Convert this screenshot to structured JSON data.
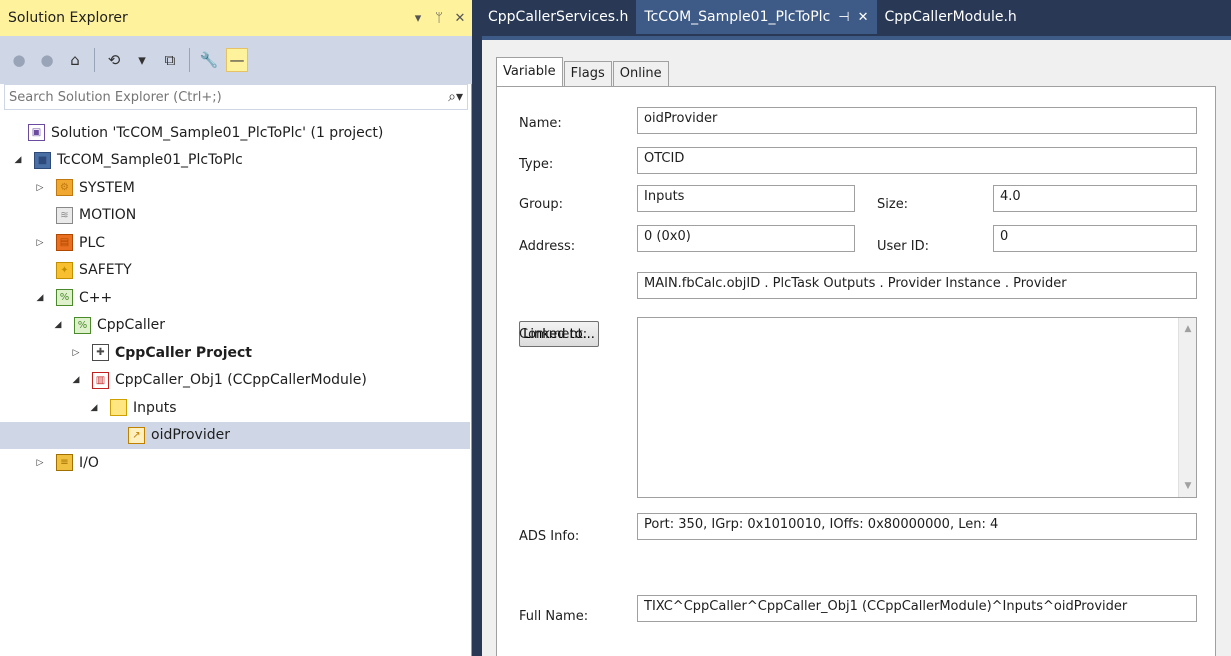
{
  "solution_explorer": {
    "title": "Solution Explorer",
    "title_controls": [
      "▾",
      "ᛘ",
      "✕"
    ],
    "toolbar": [
      "●",
      "●",
      "⌂",
      "⟲",
      "▾",
      "⧉",
      "🔧",
      "—"
    ],
    "search_placeholder": "Search Solution Explorer (Ctrl+;)",
    "tree": [
      {
        "label": "Solution 'TcCOM_Sample01_PlcToPlc' (1 project)",
        "icon": "solution-icon",
        "level": 0,
        "arrow": "",
        "bold": false,
        "selected": false
      },
      {
        "label": "TcCOM_Sample01_PlcToPlc",
        "icon": "project-icon",
        "level": 0,
        "arrow": "◢",
        "bold": false,
        "selected": false
      },
      {
        "label": "SYSTEM",
        "icon": "system-icon",
        "level": 1,
        "arrow": "▷",
        "bold": false,
        "selected": false
      },
      {
        "label": "MOTION",
        "icon": "motion-icon",
        "level": 1,
        "arrow": "",
        "bold": false,
        "selected": false
      },
      {
        "label": "PLC",
        "icon": "plc-icon",
        "level": 1,
        "arrow": "▷",
        "bold": false,
        "selected": false
      },
      {
        "label": "SAFETY",
        "icon": "safety-icon",
        "level": 1,
        "arrow": "",
        "bold": false,
        "selected": false
      },
      {
        "label": "C++",
        "icon": "cpp-icon",
        "level": 1,
        "arrow": "◢",
        "bold": false,
        "selected": false
      },
      {
        "label": "CppCaller",
        "icon": "cpp-icon",
        "level": 2,
        "arrow": "◢",
        "bold": false,
        "selected": false
      },
      {
        "label": "CppCaller Project",
        "icon": "cpp-project-icon",
        "level": 3,
        "arrow": "▷",
        "bold": true,
        "selected": false
      },
      {
        "label": "CppCaller_Obj1 (CCppCallerModule)",
        "icon": "module-icon",
        "level": 3,
        "arrow": "◢",
        "bold": false,
        "selected": false
      },
      {
        "label": "Inputs",
        "icon": "folder-icon",
        "level": 4,
        "arrow": "◢",
        "bold": false,
        "selected": false
      },
      {
        "label": "oidProvider",
        "icon": "variable-icon",
        "level": 5,
        "arrow": "",
        "bold": false,
        "selected": true
      },
      {
        "label": "I/O",
        "icon": "io-icon",
        "level": 1,
        "arrow": "▷",
        "bold": false,
        "selected": false
      }
    ]
  },
  "document_tabs": [
    {
      "label": "CppCallerServices.h",
      "active": false,
      "pin": ""
    },
    {
      "label": "TcCOM_Sample01_PlcToPlc",
      "active": true,
      "pin": "⊣"
    },
    {
      "label": "CppCallerModule.h",
      "active": false,
      "pin": ""
    }
  ],
  "properties": {
    "tabs": [
      "Variable",
      "Flags",
      "Online"
    ],
    "active_tab": "Variable",
    "name_label": "Name:",
    "name_value": "oidProvider",
    "type_label": "Type:",
    "type_value": "OTCID",
    "group_label": "Group:",
    "group_value": "Inputs",
    "size_label": "Size:",
    "size_value": "4.0",
    "address_label": "Address:",
    "address_value": "0 (0x0)",
    "userid_label": "User ID:",
    "userid_value": "0",
    "linked_button": "Linked to...",
    "linked_value": "MAIN.fbCalc.objID . PlcTask Outputs . Provider Instance . Provider",
    "comment_label": "Comment:",
    "comment_value": "",
    "ads_label": "ADS Info:",
    "ads_value": "Port: 350, IGrp: 0x1010010, IOffs: 0x80000000, Len: 4",
    "fullname_label": "Full Name:",
    "fullname_value": "TIXC^CppCaller^CppCaller_Obj1 (CCppCallerModule)^Inputs^oidProvider"
  },
  "colors": {
    "title_bar_active": "#fff29d",
    "frame": "#293955",
    "selection": "#cfd6e5"
  }
}
